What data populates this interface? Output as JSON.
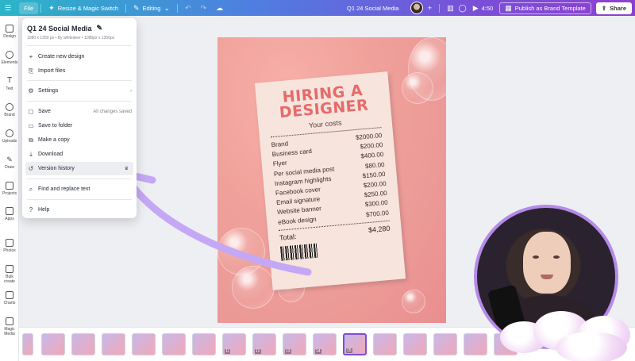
{
  "topbar": {
    "file_label": "File",
    "resize_label": "Resize & Magic Switch",
    "editing_label": "Editing",
    "doc_title": "Q1 24 Social Media",
    "timer": "4:50",
    "publish_label": "Publish as Brand Template",
    "share_label": "Share"
  },
  "rail": {
    "items": [
      "Design",
      "Elements",
      "Text",
      "Brand",
      "Uploads",
      "Draw",
      "Projects",
      "Apps",
      "Photos",
      "Bulk create",
      "Charts",
      "Magic Media"
    ]
  },
  "menu": {
    "title": "Q1 24 Social Media",
    "meta": "1080 x 1350 px • By whitedeer • 1080px x 1350px",
    "create_new": "Create new design",
    "import_files": "Import files",
    "settings": "Settings",
    "save": "Save",
    "save_status": "All changes saved",
    "save_to_folder": "Save to folder",
    "make_copy": "Make a copy",
    "download": "Download",
    "version_history": "Version history",
    "find_replace": "Find and replace text",
    "help": "Help"
  },
  "design": {
    "heading_line1": "HIRING A",
    "heading_line2": "DESIGNER",
    "subheading": "Your costs",
    "rows": [
      {
        "label": "Brand",
        "price": "$2000.00"
      },
      {
        "label": "Business card",
        "price": "$200.00"
      },
      {
        "label": "Flyer",
        "price": "$400.00"
      },
      {
        "label": "Per social media post",
        "price": "$80.00"
      },
      {
        "label": "Instagram highlights",
        "price": "$150.00"
      },
      {
        "label": "Facebook cover",
        "price": "$200.00"
      },
      {
        "label": "Email signature",
        "price": "$250.00"
      },
      {
        "label": "Website banner",
        "price": "$300.00"
      },
      {
        "label": "eBook design",
        "price": "$700.00"
      }
    ],
    "total_label": "Total:",
    "total_value": "$4,280"
  },
  "strip": {
    "pages": [
      "",
      "",
      "",
      "",
      "",
      "",
      "",
      "11",
      "12",
      "13",
      "14",
      "15",
      "",
      "",
      "",
      "",
      ""
    ],
    "selected_index": 11
  },
  "colors": {
    "accent": "#7d4fd6",
    "arrow": "#c5a8f5"
  }
}
